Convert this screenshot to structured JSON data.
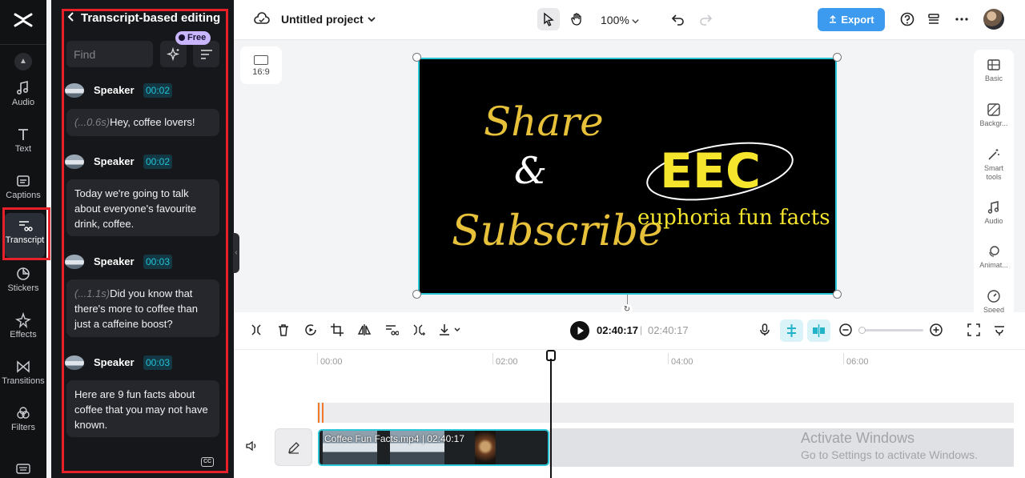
{
  "rail": {
    "items": [
      {
        "label": "Audio"
      },
      {
        "label": "Text"
      },
      {
        "label": "Captions"
      },
      {
        "label": "Transcript"
      },
      {
        "label": "Stickers"
      },
      {
        "label": "Effects"
      },
      {
        "label": "Transitions"
      },
      {
        "label": "Filters"
      }
    ],
    "active": "Transcript"
  },
  "panel": {
    "title": "Transcript-based editing",
    "badge": "Free",
    "find_placeholder": "Find",
    "segments": [
      {
        "speaker": "Speaker",
        "time": "00:02",
        "pause": "(...0.6s)",
        "text": "Hey, coffee lovers!"
      },
      {
        "speaker": "Speaker",
        "time": "00:02",
        "pause": "",
        "text": "Today we're going to talk about everyone's favourite drink, coffee."
      },
      {
        "speaker": "Speaker",
        "time": "00:03",
        "pause": "(...1.1s)",
        "text": "Did you know that there's more to coffee than just a caffeine boost?"
      },
      {
        "speaker": "Speaker",
        "time": "00:03",
        "pause": "",
        "text": "Here are 9 fun facts about coffee that you may not have known."
      }
    ]
  },
  "topbar": {
    "project_title": "Untitled project",
    "zoom": "100%",
    "export_label": "Export"
  },
  "canvas": {
    "ratio": "16:9",
    "video_text": {
      "share": "Share",
      "amp": "&",
      "subscribe": "Subscribe",
      "logo": "EEC",
      "brand": "euphoria fun facts"
    },
    "colors": {
      "gold": "#e8c13a",
      "logo_yellow": "#f5e52d",
      "accent": "#29c6d8"
    }
  },
  "rightbar": {
    "items": [
      {
        "label": "Basic"
      },
      {
        "label": "Backgr..."
      },
      {
        "label": "Smart tools"
      },
      {
        "label": "Audio"
      },
      {
        "label": "Animat..."
      },
      {
        "label": "Speed"
      }
    ]
  },
  "timeline": {
    "current_time": "02:40:17",
    "separator": "|",
    "total_time": "02:40:17",
    "ticks": [
      "00:00",
      "02:00",
      "04:00",
      "06:00"
    ],
    "clip_label": "Coffee Fun Facts.mp4 | 02:40:17"
  },
  "watermark": {
    "title": "Activate Windows",
    "subtitle": "Go to Settings to activate Windows."
  }
}
